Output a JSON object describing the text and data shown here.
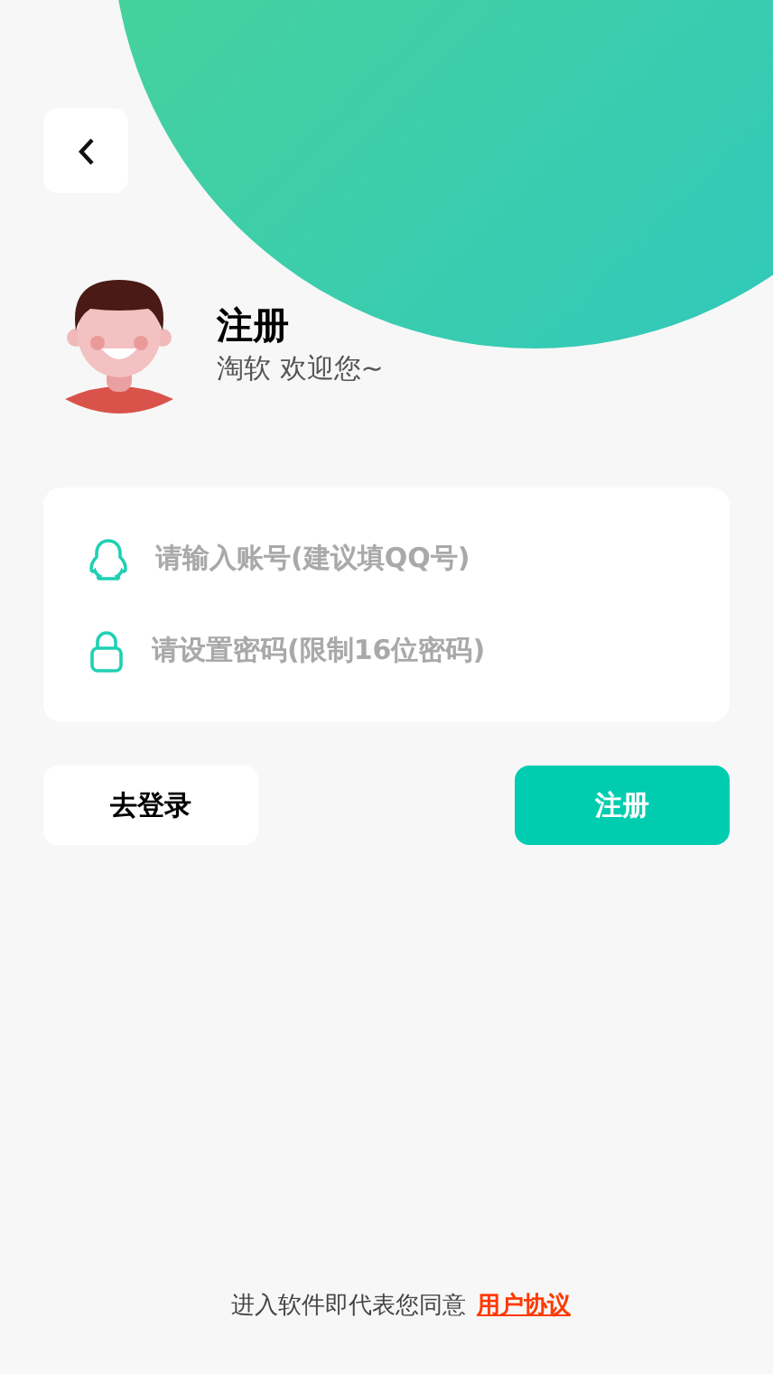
{
  "header": {
    "title": "注册",
    "subtitle": "淘软 欢迎您~"
  },
  "form": {
    "fields": [
      {
        "kind": "account",
        "placeholder": "请输入账号(建议填QQ号)"
      },
      {
        "kind": "password",
        "placeholder": "请设置密码(限制16位密码)"
      }
    ]
  },
  "buttons": {
    "login": "去登录",
    "register": "注册"
  },
  "footer": {
    "text": "进入软件即代表您同意",
    "link": "用户协议"
  }
}
